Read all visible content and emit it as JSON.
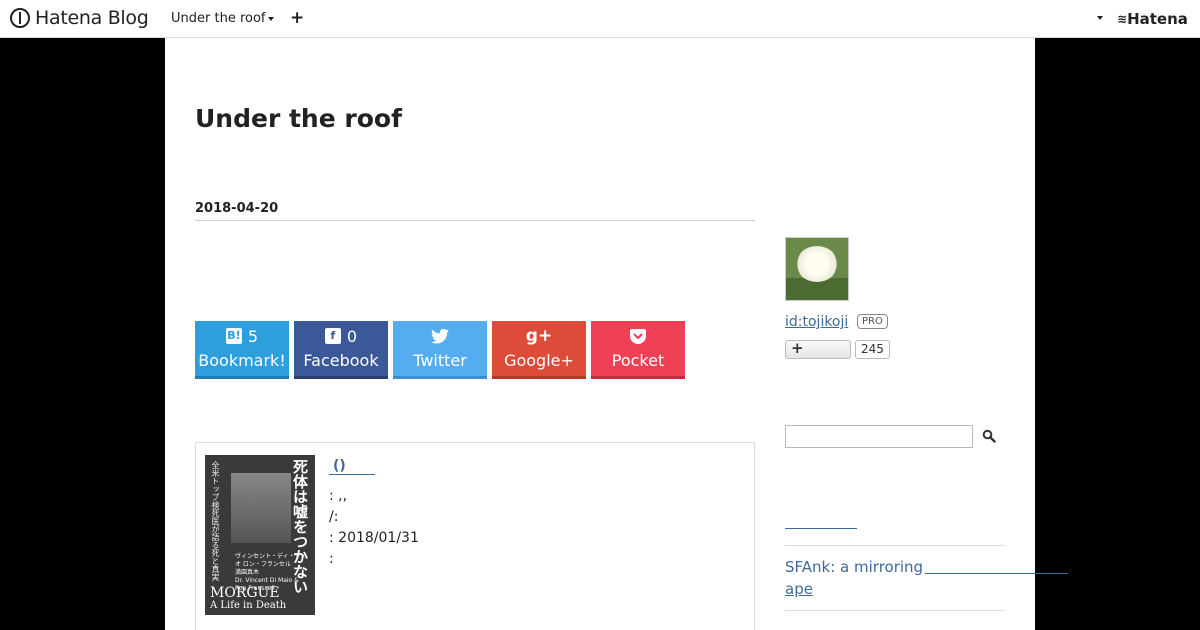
{
  "topbar": {
    "brand": "Hatena Blog",
    "blog_menu": "Under the roof",
    "plus": "+",
    "hatena": "Hatena"
  },
  "blog": {
    "title": "Under the roof"
  },
  "entry": {
    "date": "2018-04-20"
  },
  "share": {
    "hatena": {
      "count": "5",
      "label": "Bookmark!",
      "icon": "B!"
    },
    "facebook": {
      "count": "0",
      "label": "Facebook",
      "icon": "f"
    },
    "twitter": {
      "label": "Twitter",
      "icon": "twitter-bird"
    },
    "google": {
      "label": "Google+",
      "icon": "g+"
    },
    "pocket": {
      "label": "Pocket",
      "icon": "pocket"
    }
  },
  "book": {
    "cover_title": "死体は嘘をつかない",
    "cover_subtitle": "全米トップ検死医が語る死と真実",
    "cover_authors": "ヴィンセント・ディ・マイオ ロン・フランセル",
    "cover_translator": "満園真木 ",
    "cover_en": "Dr. Vincent Di Maio & Ron Franscell",
    "cover_morgue": "MORGUE",
    "cover_sub_en": "A Life in Death",
    "link_text": "()",
    "meta_1": ":   ,,",
    "meta_2": "/:",
    "meta_3": ":   2018/01/31",
    "meta_4": ":"
  },
  "sidebar": {
    "user_id": "id:tojikoji",
    "pro_badge": "PRO",
    "follow_plus": "+",
    "follow_count": "245",
    "entry_line1": "SFAnk: a mirroring",
    "entry_line2": "ape"
  }
}
